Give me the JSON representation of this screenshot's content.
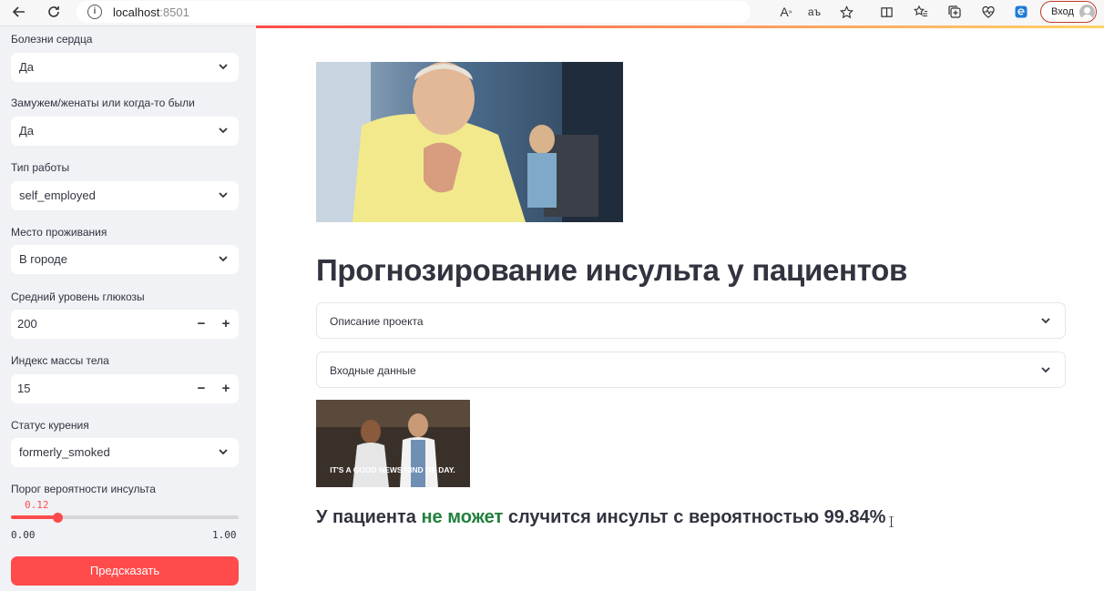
{
  "browser": {
    "url_host": "localhost",
    "url_port": ":8501",
    "login_label": "Вход",
    "icons": [
      "back-icon",
      "reload-icon",
      "info-icon",
      "read-aloud-icon",
      "translate-icon",
      "favorite-icon",
      "split-screen-icon",
      "favorites-icon",
      "collections-icon",
      "performance-icon",
      "edge-icon",
      "avatar-icon"
    ]
  },
  "sidebar": {
    "heart_disease": {
      "label": "Болезни сердца",
      "value": "Да"
    },
    "married": {
      "label": "Замужем/женаты или когда-то были",
      "value": "Да"
    },
    "work_type": {
      "label": "Тип работы",
      "value": "self_employed"
    },
    "residence": {
      "label": "Место проживания",
      "value": "В городе"
    },
    "glucose": {
      "label": "Средний уровень глюкозы",
      "value": "200",
      "minus": "−",
      "plus": "+"
    },
    "bmi": {
      "label": "Индекс массы тела",
      "value": "15",
      "minus": "−",
      "plus": "+"
    },
    "smoking": {
      "label": "Статус курения",
      "value": "formerly_smoked"
    },
    "threshold": {
      "label": "Порог вероятности инсульта",
      "value_text": "0.12",
      "value": 0.12,
      "min_text": "0.00",
      "max_text": "1.00"
    },
    "predict_label": "Предсказать"
  },
  "main": {
    "title": "Прогнозирование инсульта у пациентов",
    "expanders": [
      {
        "label": "Описание проекта"
      },
      {
        "label": "Входные данные"
      }
    ],
    "gif_caption": "IT'S A GOOD NEWS KIND OF DAY.",
    "result": {
      "prefix": "У пациента ",
      "highlight": "не может",
      "suffix": " случится инсульт с вероятностью 99.84%"
    }
  },
  "colors": {
    "accent": "#ff4b4b",
    "sidebar_bg": "#f0f2f6",
    "success": "#21813e",
    "text": "#31333f"
  }
}
